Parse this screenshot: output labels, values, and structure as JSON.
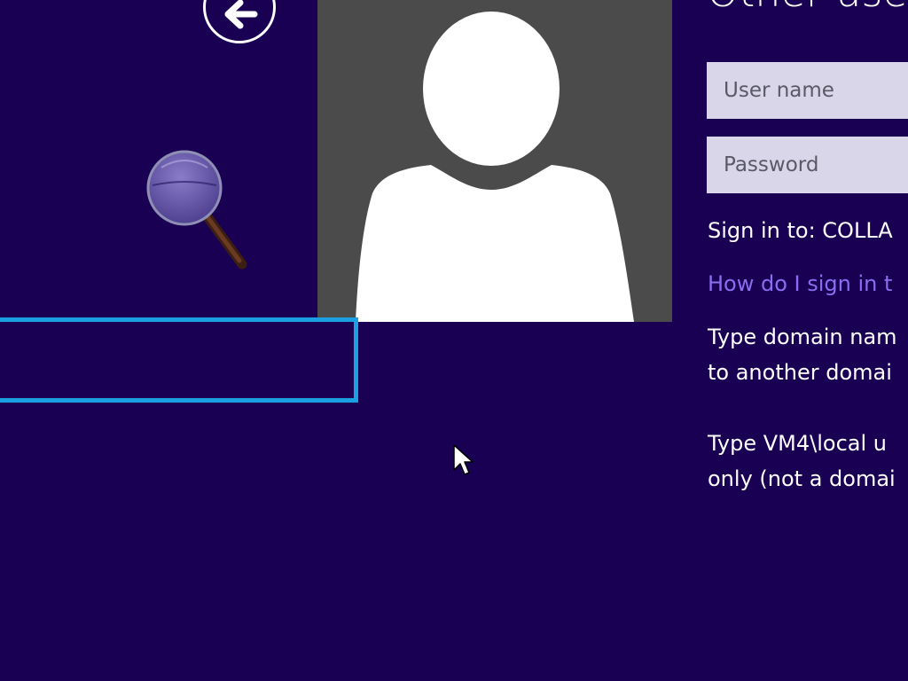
{
  "screen": {
    "title": "Other user",
    "background_color": "#190052",
    "focus_color": "#1ba1e2"
  },
  "navigation": {
    "back_icon": "arrow-left-icon"
  },
  "decoration": {
    "magnifier_icon": "magnifier-icon"
  },
  "account_tile": {
    "avatar_icon": "user-silhouette-icon",
    "tile_color": "#4b4b4b"
  },
  "form": {
    "username_placeholder": "User name",
    "password_placeholder": "Password",
    "sign_in_to": "Sign in to: COLLA",
    "help_link": "How do I sign in t",
    "hint_one": [
      "Type domain nam",
      "to another domai"
    ],
    "hint_two": [
      "Type VM4\\local u",
      "only (not a domai"
    ]
  },
  "pointer": {
    "icon": "mouse-pointer-icon"
  }
}
